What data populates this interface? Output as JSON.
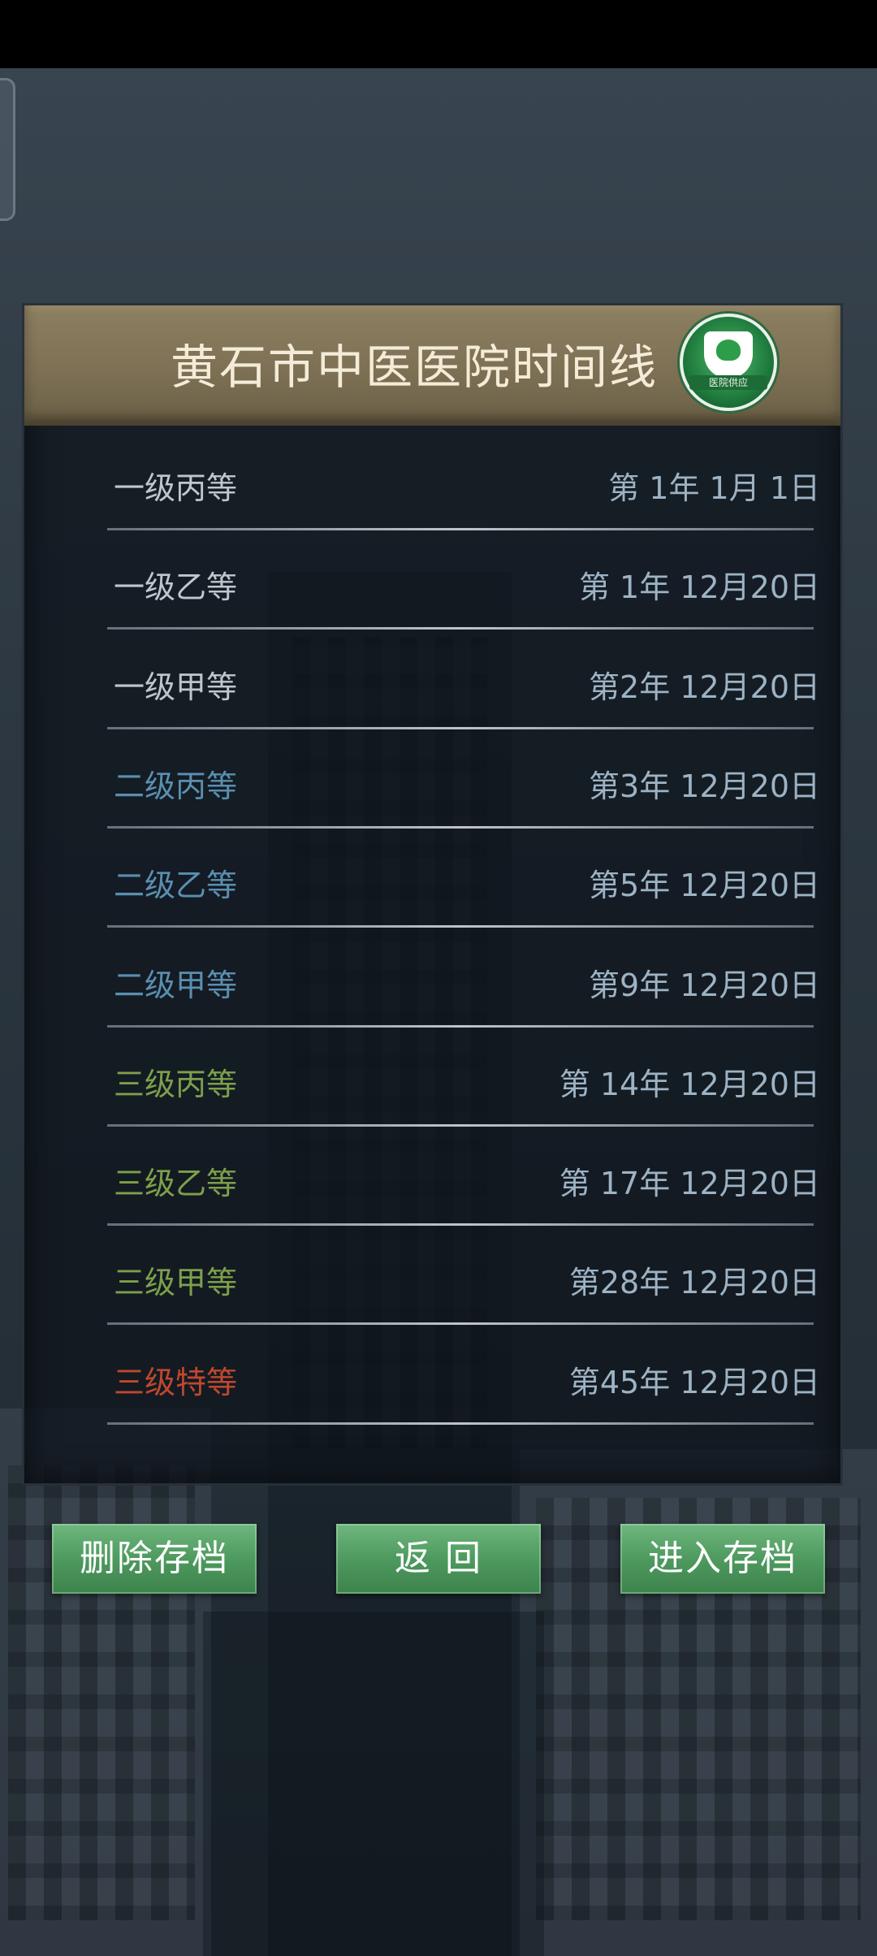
{
  "panel": {
    "title": "黄石市中医医院时间线"
  },
  "badge": {
    "text": "医院供应"
  },
  "timeline": [
    {
      "level": "一级丙等",
      "date": "第 1年 1月 1日",
      "color": "#bfc6cc"
    },
    {
      "level": "一级乙等",
      "date": "第 1年 12月20日",
      "color": "#bfc6cc"
    },
    {
      "level": "一级甲等",
      "date": "第2年 12月20日",
      "color": "#bfc6cc"
    },
    {
      "level": "二级丙等",
      "date": "第3年 12月20日",
      "color": "#5a8fb0"
    },
    {
      "level": "二级乙等",
      "date": "第5年 12月20日",
      "color": "#5a8fb0"
    },
    {
      "level": "二级甲等",
      "date": "第9年 12月20日",
      "color": "#5a8fb0"
    },
    {
      "level": "三级丙等",
      "date": "第 14年 12月20日",
      "color": "#7da04a"
    },
    {
      "level": "三级乙等",
      "date": "第 17年 12月20日",
      "color": "#7da04a"
    },
    {
      "level": "三级甲等",
      "date": "第28年 12月20日",
      "color": "#7da04a"
    },
    {
      "level": "三级特等",
      "date": "第45年 12月20日",
      "color": "#c0472e"
    }
  ],
  "buttons": {
    "delete_label": "删除存档",
    "back_label": "返 回",
    "enter_label": "进入存档"
  }
}
